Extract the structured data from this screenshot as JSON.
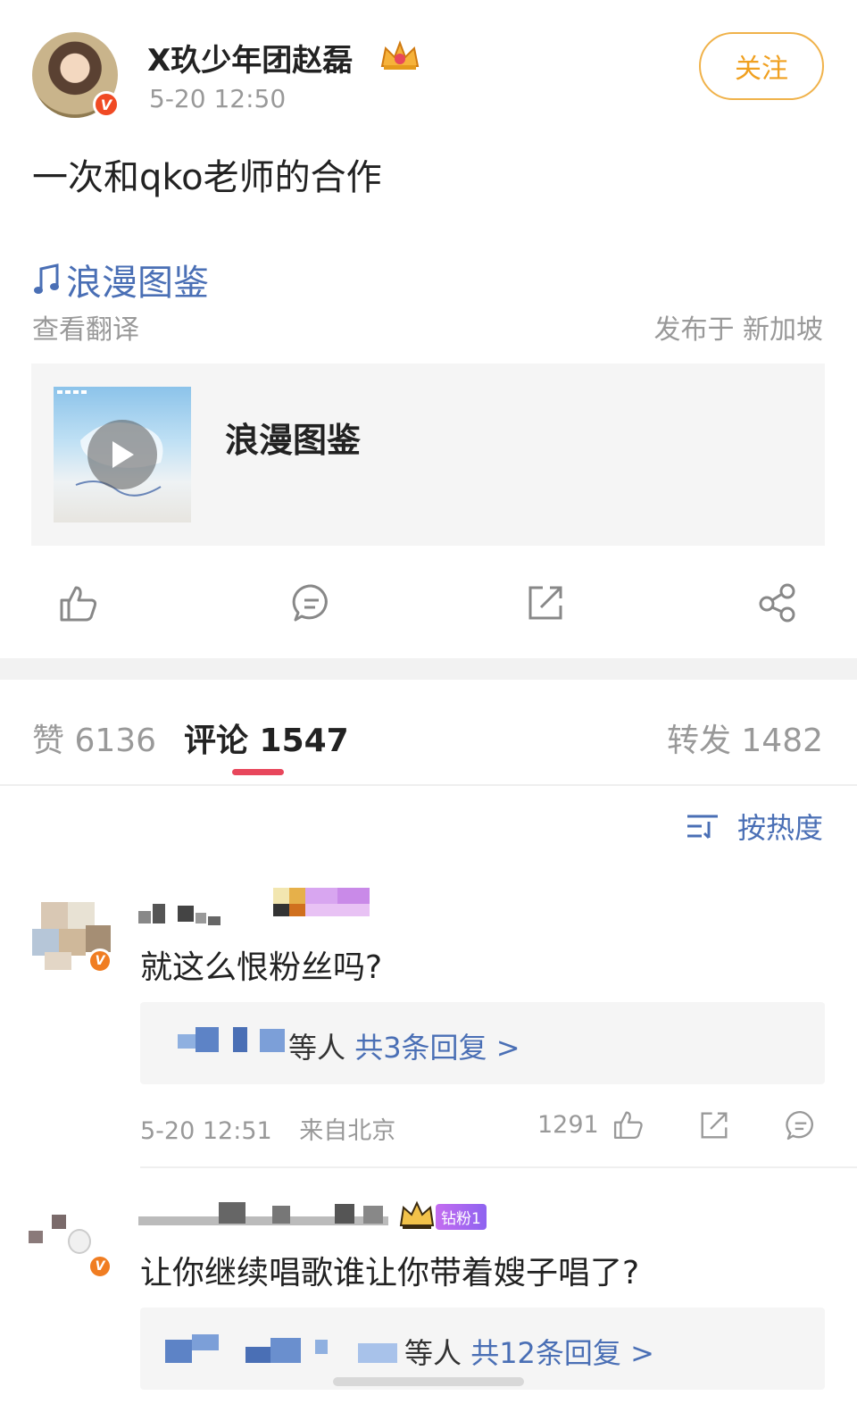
{
  "post": {
    "author": "X玖少年团赵磊",
    "time": "5-20 12:50",
    "follow_label": "关注",
    "text": "一次和qko老师的合作",
    "music_link": "浪漫图鉴",
    "translate": "查看翻译",
    "location": "发布于 新加坡",
    "card_title": "浪漫图鉴"
  },
  "actions": [
    "like-icon",
    "comment-icon",
    "repost-icon",
    "share-icon"
  ],
  "tabs": {
    "like": "赞 6136",
    "comment": "评论 1547",
    "repost": "转发 1482"
  },
  "sort": {
    "icon": "sort-icon",
    "label": "按热度"
  },
  "comments": [
    {
      "text": "就这么恨粉丝吗?",
      "reply_who": "等人",
      "reply_count": "共3条回复 >",
      "time": "5-20 12:51",
      "from": "来自北京",
      "likes": "1291"
    },
    {
      "badge": "钻粉1",
      "text": "让你继续唱歌谁让你带着嫂子唱了?",
      "reply_who": "等人",
      "reply_count": "共12条回复 >"
    }
  ],
  "colors": {
    "accent_blue": "#4a6fb5",
    "follow_orange": "#f0a020",
    "tab_indicator": "#e8475c",
    "verified_red": "#f04a24"
  }
}
